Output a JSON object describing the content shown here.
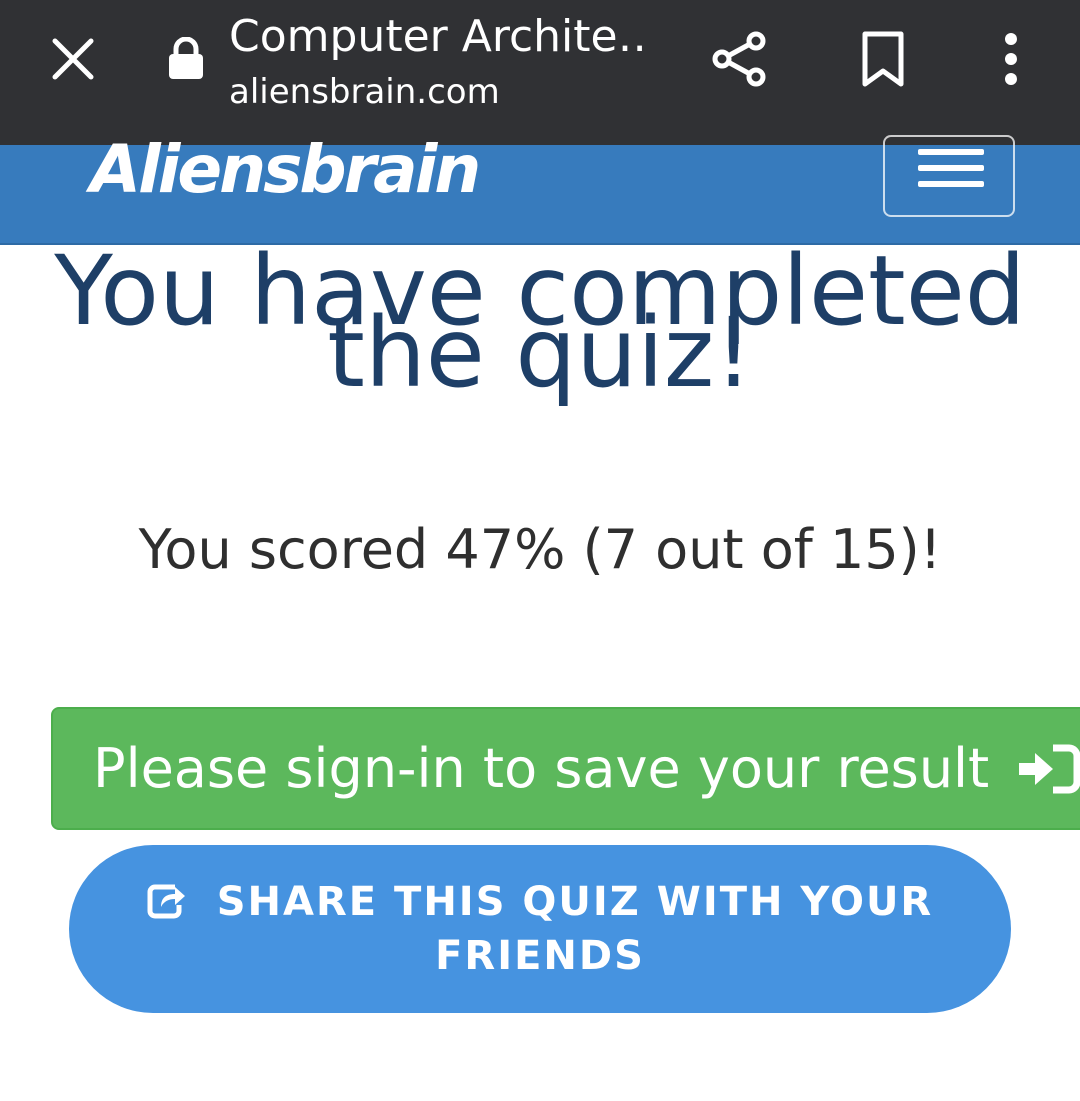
{
  "browser": {
    "tab_title": "Computer Archite…",
    "url": "aliensbrain.com",
    "colors": {
      "bar": "#303134",
      "icon": "#ffffff"
    },
    "icons": [
      "close-icon",
      "lock-icon",
      "share-icon",
      "bookmark-icon",
      "more-vert-icon"
    ]
  },
  "site": {
    "brand": "Aliensbrain",
    "header_color": "#377bbd",
    "menu_icon": "hamburger-menu-icon"
  },
  "result": {
    "title": "You have completed the quiz!",
    "score_text": "You scored 47% (7 out of 15)!",
    "title_color": "#1e3f67"
  },
  "actions": {
    "signin_label": "Please sign-in to save your result",
    "signin_color": "#5cb85c",
    "signin_icon": "sign-in-icon",
    "share_label": "SHARE THIS QUIZ WITH YOUR FRIENDS",
    "share_color": "#4693e0",
    "share_icon": "share-square-icon"
  }
}
